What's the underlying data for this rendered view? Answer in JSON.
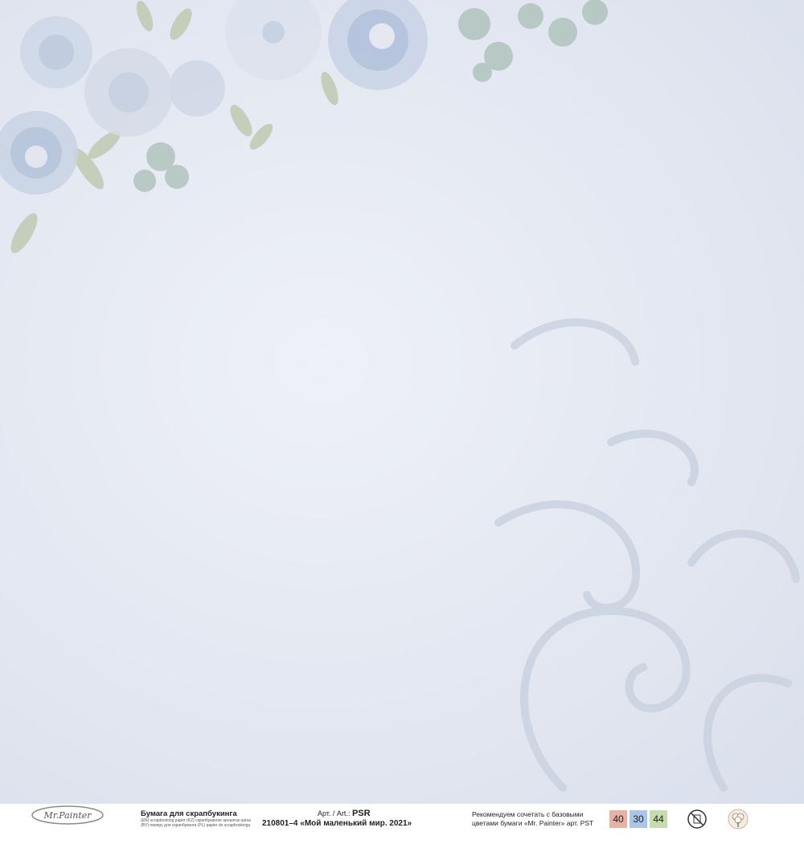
{
  "brand": {
    "logo_text": "Mr.Painter"
  },
  "product": {
    "paper_title": "Бумага для скрапбукинга",
    "paper_sub_lines": [
      "(EN) scrapbooking paper (KZ) скрапбукингке арналған қағаз",
      "(BY) паперу для скрапбукинга (PL) papier do scrapbookingu"
    ],
    "art_prefix": "Арт. / Art.:",
    "art_code": "PSR",
    "product_line": "210801–4 «Мой маленький мир. 2021»"
  },
  "recommend": {
    "line1": "Рекомендуем сочетать с базовыми",
    "line2": "цветами бумаги «Mr. Painter» арт. PST"
  },
  "swatches": [
    {
      "label": "40",
      "color": "#e8b1a6"
    },
    {
      "label": "30",
      "color": "#a9c6e8"
    },
    {
      "label": "44",
      "color": "#c5dcae"
    }
  ],
  "icons": [
    "no-acid-icon",
    "cotton-icon"
  ],
  "colors": {
    "background": "#e3e7f0",
    "flower": "#b8c8dc",
    "leaf": "#a9bdb0",
    "swirl": "#c3ccdc"
  }
}
